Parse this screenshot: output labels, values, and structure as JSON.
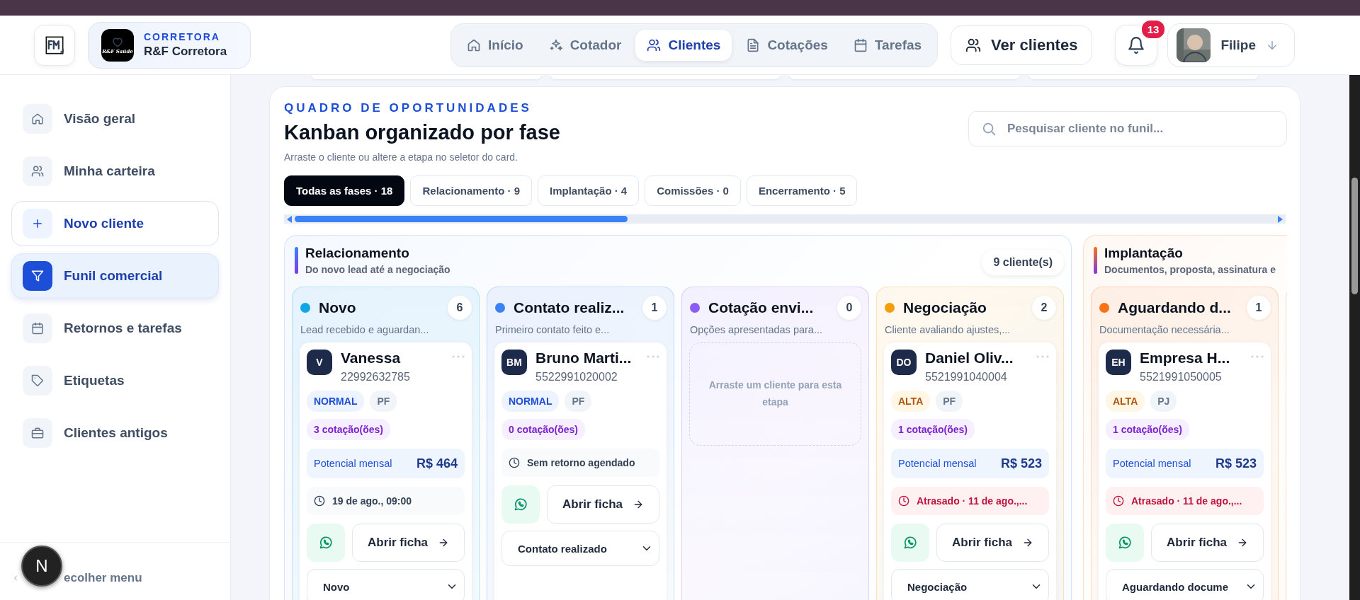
{
  "brand": {
    "eyebrow": "CORRETORA",
    "name": "R&F Corretora",
    "logo_text": "R&F Saúde"
  },
  "nav": [
    {
      "label": "Início",
      "selected": false
    },
    {
      "label": "Cotador",
      "selected": false
    },
    {
      "label": "Clientes",
      "selected": true
    },
    {
      "label": "Cotações",
      "selected": false
    },
    {
      "label": "Tarefas",
      "selected": false
    }
  ],
  "header_button": {
    "label": "Ver clientes"
  },
  "notifications": {
    "count": "13"
  },
  "user": {
    "name": "Filipe"
  },
  "sidebar": {
    "items": [
      {
        "label": "Visão geral",
        "kind": "link",
        "selected": false
      },
      {
        "label": "Minha carteira",
        "kind": "link",
        "selected": false
      },
      {
        "label": "Novo cliente",
        "kind": "action",
        "selected": false
      },
      {
        "label": "Funil comercial",
        "kind": "link",
        "selected": true
      },
      {
        "label": "Retornos e tarefas",
        "kind": "link",
        "selected": false
      },
      {
        "label": "Etiquetas",
        "kind": "link",
        "selected": false
      },
      {
        "label": "Clientes antigos",
        "kind": "link",
        "selected": false
      }
    ],
    "collapse_label": "ecolher menu",
    "dev_badge": "N"
  },
  "board": {
    "eyebrow": "QUADRO DE OPORTUNIDADES",
    "title": "Kanban organizado por fase",
    "subtitle": "Arraste o cliente ou altere a etapa no seletor do card.",
    "search": {
      "placeholder": "Pesquisar cliente no funil..."
    },
    "filters": [
      {
        "label": "Todas as fases · 18",
        "selected": true
      },
      {
        "label": "Relacionamento · 9",
        "selected": false
      },
      {
        "label": "Implantação · 4",
        "selected": false
      },
      {
        "label": "Comissões · 0",
        "selected": false
      },
      {
        "label": "Encerramento · 5",
        "selected": false
      }
    ],
    "groups": [
      {
        "title": "Relacionamento",
        "subtitle": "Do novo lead até a negociação",
        "count": "9 cliente(s)",
        "color": "#3b82f6",
        "columns": [
          {
            "name": "Novo",
            "description": "Lead recebido e aguardan...",
            "count": "6",
            "color": "#0ea5e9",
            "cards": [
              {
                "initials": "V",
                "name": "Vanessa",
                "phone": "22992632785",
                "priority": {
                  "label": "NORMAL",
                  "kind": "normal"
                },
                "type": "PF",
                "quotes": "3 cotação(ões)",
                "potential": {
                  "label": "Potencial mensal",
                  "value": "R$ 464"
                },
                "schedule": {
                  "text": "19 de ago., 09:00",
                  "overdue": false
                },
                "action": "Abrir ficha",
                "stage": "Novo"
              }
            ]
          },
          {
            "name": "Contato realiz...",
            "description": "Primeiro contato feito e...",
            "count": "1",
            "color": "#3b82f6",
            "cards": [
              {
                "initials": "BM",
                "name": "Bruno Marti...",
                "phone": "5522991020002",
                "priority": {
                  "label": "NORMAL",
                  "kind": "normal"
                },
                "type": "PF",
                "quotes": "0 cotação(ões)",
                "schedule": {
                  "text": "Sem retorno agendado",
                  "overdue": false
                },
                "action": "Abrir ficha",
                "stage": "Contato realizado"
              }
            ]
          },
          {
            "name": "Cotação envi...",
            "description": "Opções apresentadas para...",
            "count": "0",
            "color": "#8b5cf6",
            "empty_text": "Arraste um cliente para esta etapa"
          },
          {
            "name": "Negociação",
            "description": "Cliente avaliando ajustes,...",
            "count": "2",
            "color": "#f59e0b",
            "cards": [
              {
                "initials": "DO",
                "name": "Daniel Oliv...",
                "phone": "5521991040004",
                "priority": {
                  "label": "ALTA",
                  "kind": "high"
                },
                "type": "PF",
                "quotes": "1 cotação(ões)",
                "potential": {
                  "label": "Potencial mensal",
                  "value": "R$ 523"
                },
                "schedule": {
                  "text": "Atrasado · 11 de ago.,...",
                  "overdue": true
                },
                "action": "Abrir ficha",
                "stage": "Negociação"
              }
            ]
          }
        ]
      },
      {
        "title": "Implantação",
        "subtitle": "Documentos, proposta, assinatura e",
        "color": "#f97316",
        "columns": [
          {
            "name": "Aguardando d...",
            "description": "Documentação necessária...",
            "count": "1",
            "color": "#f97316",
            "cards": [
              {
                "initials": "EH",
                "name": "Empresa H...",
                "phone": "5521991050005",
                "priority": {
                  "label": "ALTA",
                  "kind": "high"
                },
                "type": "PJ",
                "quotes": "1 cotação(ões)",
                "potential": {
                  "label": "Potencial mensal",
                  "value": "R$ 523"
                },
                "schedule": {
                  "text": "Atrasado · 11 de ago.,...",
                  "overdue": true
                },
                "action": "Abrir ficha",
                "stage": "Aguardando docume"
              }
            ]
          }
        ]
      }
    ]
  }
}
